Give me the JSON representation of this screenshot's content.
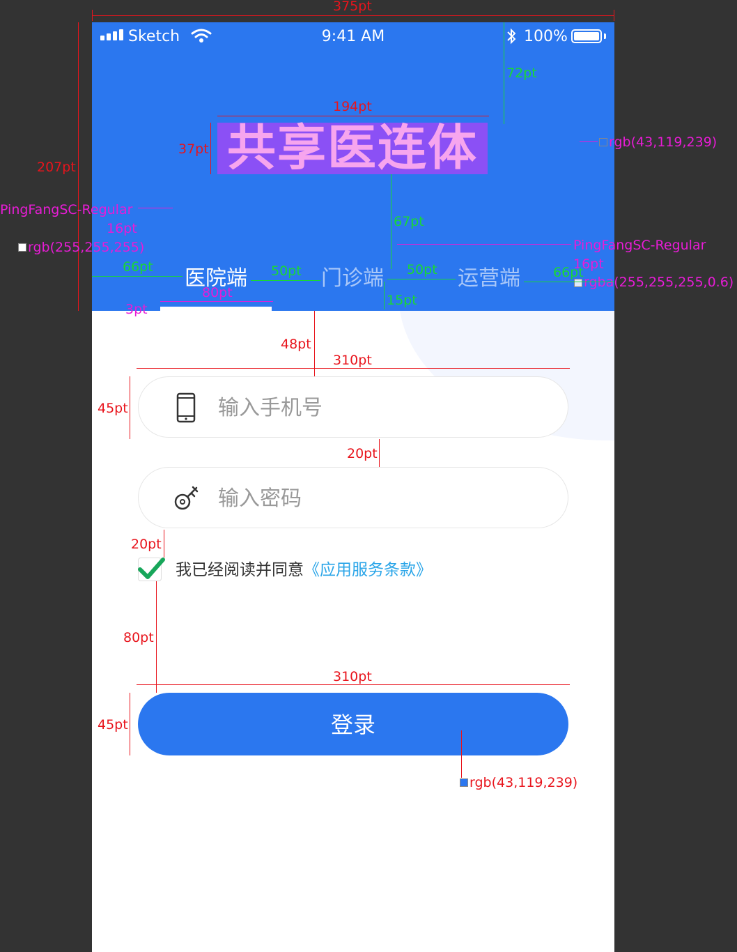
{
  "status_bar": {
    "carrier": "Sketch",
    "time": "9:41 AM",
    "battery": "100%"
  },
  "header": {
    "title": "共享医连体",
    "tabs": [
      {
        "label": "医院端",
        "active": true
      },
      {
        "label": "门诊端",
        "active": false
      },
      {
        "label": "运营端",
        "active": false
      }
    ],
    "background_color": "#2b77ef"
  },
  "form": {
    "phone": {
      "value": "",
      "placeholder": "输入手机号",
      "icon": "phone-icon"
    },
    "password": {
      "value": "",
      "placeholder": "输入密码",
      "icon": "key-icon"
    },
    "agreement": {
      "checked": true,
      "text": "我已经阅读并同意",
      "link": "《应用服务条款》"
    },
    "login_label": "登录"
  },
  "annotations": {
    "w375": "375pt",
    "h72": "72pt",
    "w194": "194pt",
    "h37": "37pt",
    "h207": "207pt",
    "h67": "67pt",
    "font_left": "PingFangSC-Regular",
    "size_left": "16pt",
    "color_white": "rgb(255,255,255)",
    "font_right": "PingFangSC-Regular",
    "size_right": "16pt",
    "color_white_06": "rgba(255,255,255,0.6)",
    "color_blue_top": "rgb(43,119,239)",
    "gap66_left": "66pt",
    "gap50_a": "50pt",
    "gap50_b": "50pt",
    "gap66_right": "66pt",
    "w80": "80pt",
    "h3": "3pt",
    "h15": "15pt",
    "h48": "48pt",
    "w310_top": "310pt",
    "h45_top": "45pt",
    "h20_a": "20pt",
    "h20_b": "20pt",
    "h80": "80pt",
    "w310_bottom": "310pt",
    "h45_bottom": "45pt",
    "color_blue_btn": "rgb(43,119,239)"
  }
}
